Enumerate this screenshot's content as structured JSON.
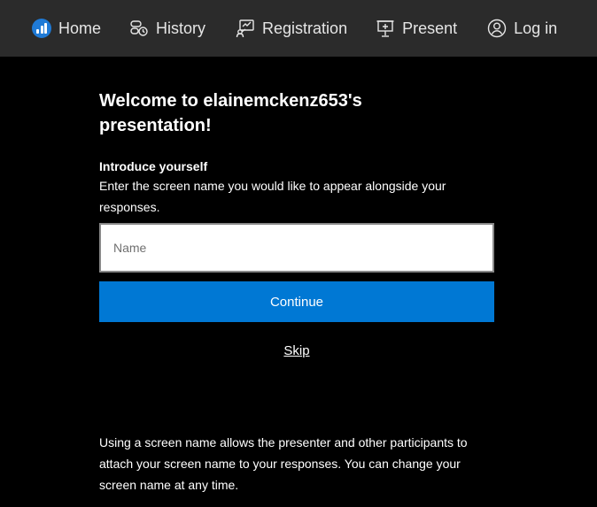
{
  "nav": {
    "home_label": "Home",
    "history_label": "History",
    "registration_label": "Registration",
    "present_label": "Present",
    "login_label": "Log in",
    "icons": {
      "home": "bar-chart-logo-icon",
      "history": "history-icon",
      "registration": "registration-icon",
      "present": "presentation-icon",
      "login": "user-circle-icon"
    }
  },
  "main": {
    "welcome_title": "Welcome to elainemckenz653's presentation!",
    "intro_heading": "Introduce yourself",
    "intro_text": "Enter the screen name you would like to appear alongside your responses.",
    "name_input": {
      "placeholder": "Name",
      "value": ""
    },
    "continue_label": "Continue",
    "skip_label": "Skip",
    "footnote": "Using a screen name allows the presenter and other participants to attach your screen name to your responses. You can change your screen name at any time."
  },
  "colors": {
    "background": "#000000",
    "nav_background": "#2b2b2b",
    "accent": "#0078d4",
    "logo": "#1f7ad6"
  }
}
